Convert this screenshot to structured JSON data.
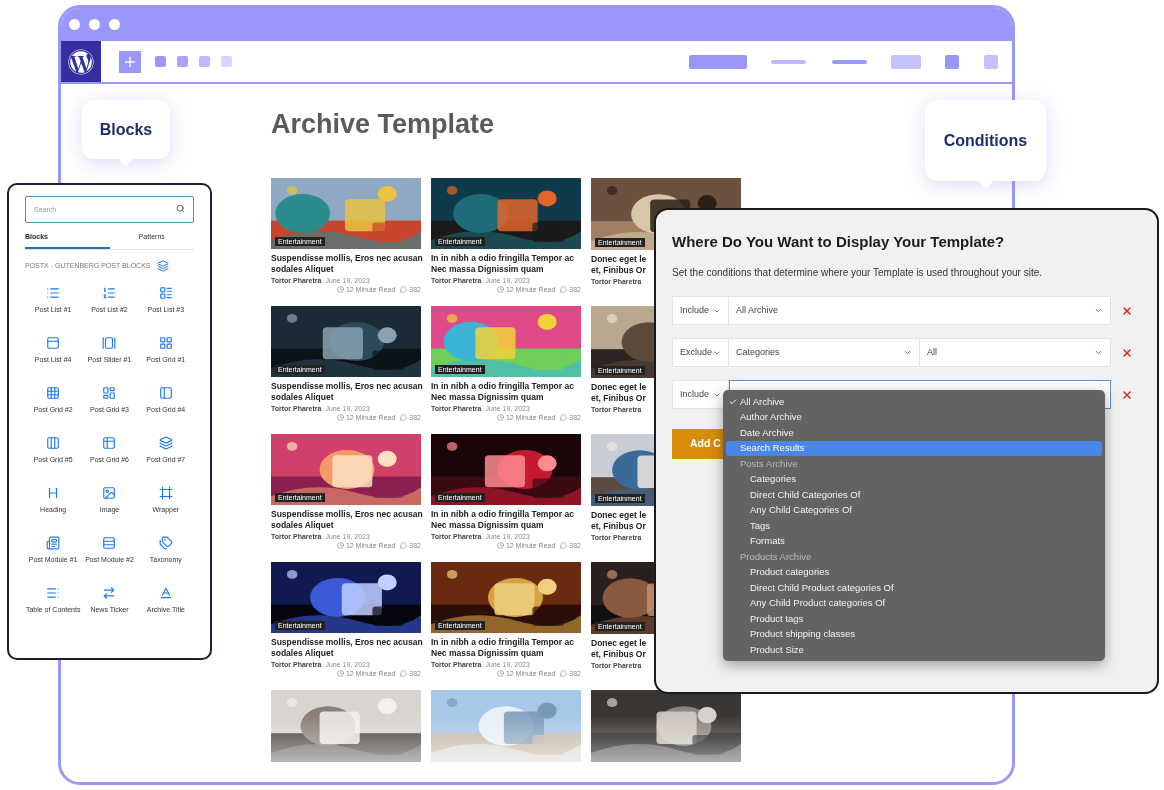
{
  "callouts": {
    "blocks": "Blocks",
    "conditions": "Conditions"
  },
  "page": {
    "title": "Archive Template"
  },
  "posts": [
    {
      "kind": "full",
      "badge": "Entertainment",
      "title": "Suspendisse mollis, Eros nec acusan\nsodales Aliquet",
      "author": "Tortor Pharetra",
      "date": "June 19, 2023",
      "read_time": "12 Minute Read",
      "comments": "382"
    },
    {
      "kind": "full",
      "badge": "Entertainment",
      "title": "In in nibh a odio fringilla Tempor ac\nNec massa Dignissim quam",
      "author": "Tortor Pharetra",
      "date": "June 19, 2023",
      "read_time": "12 Minute Read",
      "comments": "382"
    },
    {
      "kind": "cut",
      "badge": "Entertainment",
      "title": "Donec eget le\net, Finibus Or",
      "author": "Tortor Pharetra"
    },
    {
      "kind": "full",
      "badge": "Entertainment",
      "title": "Suspendisse mollis, Eros nec acusan\nsodales Aliquet",
      "author": "Tortor Pharetra",
      "date": "June 19, 2023",
      "read_time": "12 Minute Read",
      "comments": "382"
    },
    {
      "kind": "full",
      "badge": "Entertainment",
      "title": "In in nibh a odio fringilla Tempor ac\nNec massa Dignissim quam",
      "author": "Tortor Pharetra",
      "date": "June 19, 2023",
      "read_time": "12 Minute Read",
      "comments": "382"
    },
    {
      "kind": "cut",
      "badge": "Entertainment",
      "title": "Donec eget le\net, Finibus Or",
      "author": "Tortor Pharetra"
    },
    {
      "kind": "full",
      "badge": "Entertainment",
      "title": "Suspendisse mollis, Eros nec acusan\nsodales Aliquet",
      "author": "Tortor Pharetra",
      "date": "June 19, 2023",
      "read_time": "12 Minute Read",
      "comments": "382"
    },
    {
      "kind": "full",
      "badge": "Entertainment",
      "title": "In in nibh a odio fringilla Tempor ac\nNec massa Dignissim quam",
      "author": "Tortor Pharetra",
      "date": "June 19, 2023",
      "read_time": "12 Minute Read",
      "comments": "382"
    },
    {
      "kind": "cut",
      "badge": "Entertainment",
      "title": "Donec eget le\net, Finibus Or",
      "author": "Tortor Pharetra"
    },
    {
      "kind": "full",
      "badge": "Entertainment",
      "title": "Suspendisse mollis, Eros nec acusan\nsodales Aliquet",
      "author": "Tortor Pharetra",
      "date": "June 19, 2023",
      "read_time": "12 Minute Read",
      "comments": "382"
    },
    {
      "kind": "full",
      "badge": "Entertainment",
      "title": "In in nibh a odio fringilla Tempor ac\nNec massa Dignissim quam",
      "author": "Tortor Pharetra",
      "date": "June 19, 2023",
      "read_time": "12 Minute Read",
      "comments": "382"
    },
    {
      "kind": "cut",
      "badge": "Entertainment",
      "title": "Donec eget le\net, Finibus Or",
      "author": "Tortor Pharetra"
    },
    {
      "kind": "picture"
    },
    {
      "kind": "picture"
    },
    {
      "kind": "picture"
    }
  ],
  "blocks_panel": {
    "search": {
      "placeholder": "Search"
    },
    "tabs": [
      {
        "label": "Blocks",
        "selected": true
      },
      {
        "label": "Patterns",
        "selected": false
      }
    ],
    "section": "POSTX - GUTENBERG POST BLOCKS",
    "blocks": [
      "Post List #1",
      "Post List #2",
      "Post List #3",
      "Post List #4",
      "Post Slider #1",
      "Post Grid #1",
      "Post Grid #2",
      "Post Grid #3",
      "Post Grid #4",
      "Post Grid #5",
      "Post Grid #6",
      "Post Grid #7",
      "Heading",
      "Image",
      "Wrapper",
      "Post Module #1",
      "Post Module #2",
      "Taxonomy",
      "Table of Contents",
      "News Ticker",
      "Archive Title"
    ]
  },
  "conditions": {
    "title": "Where Do You Want to Display Your Template?",
    "description": "Set the conditions that determine where your Template is used throughout your site.",
    "rules": [
      {
        "mode": "Include",
        "fields": [
          "All Archive"
        ],
        "open": false
      },
      {
        "mode": "Exclude",
        "fields": [
          "Categories",
          "All"
        ],
        "open": false
      },
      {
        "mode": "Include",
        "open": true
      }
    ],
    "add_button": "Add C",
    "dropdown": [
      {
        "kind": "option",
        "label": "All Archive",
        "checked": true,
        "selected": false
      },
      {
        "kind": "option",
        "label": "Author Archive",
        "checked": false,
        "selected": false
      },
      {
        "kind": "option",
        "label": "Date Archive",
        "checked": false,
        "selected": false
      },
      {
        "kind": "option",
        "label": "Search Results",
        "checked": false,
        "selected": true
      },
      {
        "kind": "group",
        "label": "Posts Archive"
      },
      {
        "kind": "suboption",
        "label": "Categories",
        "checked": false,
        "selected": false
      },
      {
        "kind": "suboption",
        "label": "Direct Child Categories Of",
        "checked": false,
        "selected": false
      },
      {
        "kind": "suboption",
        "label": "Any Child Categories Of",
        "checked": false,
        "selected": false
      },
      {
        "kind": "suboption",
        "label": "Tags",
        "checked": false,
        "selected": false
      },
      {
        "kind": "suboption",
        "label": "Formats",
        "checked": false,
        "selected": false
      },
      {
        "kind": "group",
        "label": "Products Archive"
      },
      {
        "kind": "suboption",
        "label": "Product categories",
        "checked": false,
        "selected": false
      },
      {
        "kind": "suboption",
        "label": "Direct Child Product categories Of",
        "checked": false,
        "selected": false
      },
      {
        "kind": "suboption",
        "label": "Any Child Product categories Of",
        "checked": false,
        "selected": false
      },
      {
        "kind": "suboption",
        "label": "Product tags",
        "checked": false,
        "selected": false
      },
      {
        "kind": "suboption",
        "label": "Product shipping classes",
        "checked": false,
        "selected": false
      },
      {
        "kind": "suboption",
        "label": "Product Size",
        "checked": false,
        "selected": false
      }
    ]
  }
}
